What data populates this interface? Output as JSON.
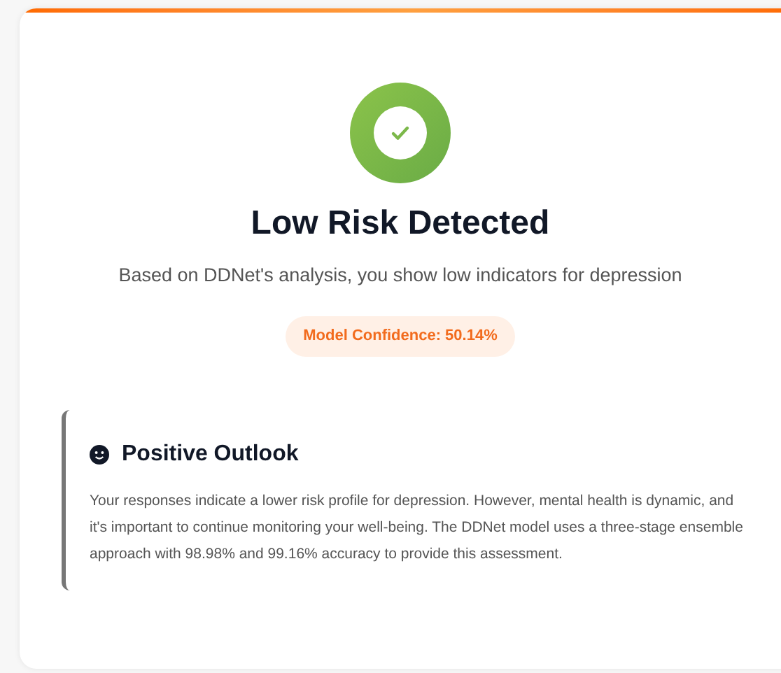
{
  "result": {
    "kind": "low",
    "title": "Low Risk Detected",
    "subtitle": "Based on DDNet's analysis, you show low indicators for depression",
    "confidence": "Model Confidence: 50.14%"
  },
  "outlook": {
    "title": "Positive Outlook",
    "text": "Your responses indicate a lower risk profile for depression. However, mental health is dynamic, and it's important to continue monitoring your well-being. The DDNet model uses a three-stage ensemble approach with 98.98% and 99.16% accuracy to provide this assessment."
  }
}
